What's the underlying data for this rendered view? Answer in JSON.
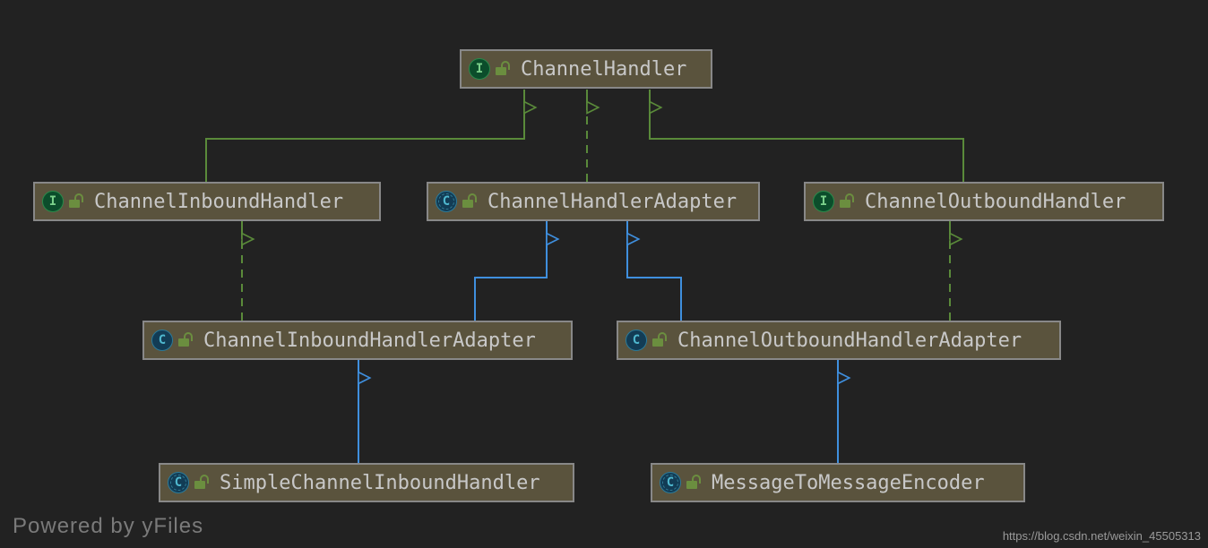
{
  "chart_data": {
    "type": "uml_class_hierarchy",
    "nodes": [
      {
        "id": "ch",
        "kind": "interface",
        "label": "ChannelHandler"
      },
      {
        "id": "cih",
        "kind": "interface",
        "label": "ChannelInboundHandler"
      },
      {
        "id": "cha",
        "kind": "abstract",
        "label": "ChannelHandlerAdapter"
      },
      {
        "id": "coh",
        "kind": "interface",
        "label": "ChannelOutboundHandler"
      },
      {
        "id": "ciha",
        "kind": "class",
        "label": "ChannelInboundHandlerAdapter"
      },
      {
        "id": "coha",
        "kind": "class",
        "label": "ChannelOutboundHandlerAdapter"
      },
      {
        "id": "scih",
        "kind": "abstract",
        "label": "SimpleChannelInboundHandler"
      },
      {
        "id": "m2me",
        "kind": "abstract",
        "label": "MessageToMessageEncoder"
      }
    ],
    "edges": [
      {
        "from": "cih",
        "to": "ch",
        "relation": "implements"
      },
      {
        "from": "cha",
        "to": "ch",
        "relation": "implements"
      },
      {
        "from": "coh",
        "to": "ch",
        "relation": "implements"
      },
      {
        "from": "ciha",
        "to": "cih",
        "relation": "implements"
      },
      {
        "from": "ciha",
        "to": "cha",
        "relation": "extends"
      },
      {
        "from": "coha",
        "to": "cha",
        "relation": "extends"
      },
      {
        "from": "coha",
        "to": "coh",
        "relation": "implements"
      },
      {
        "from": "scih",
        "to": "ciha",
        "relation": "extends"
      },
      {
        "from": "m2me",
        "to": "coha",
        "relation": "extends"
      }
    ],
    "colors": {
      "implements": "#5a8a3a",
      "extends": "#3f8fde"
    }
  },
  "nodes": {
    "ch": {
      "label": "ChannelHandler"
    },
    "cih": {
      "label": "ChannelInboundHandler"
    },
    "cha": {
      "label": "ChannelHandlerAdapter"
    },
    "coh": {
      "label": "ChannelOutboundHandler"
    },
    "ciha": {
      "label": "ChannelInboundHandlerAdapter"
    },
    "coha": {
      "label": "ChannelOutboundHandlerAdapter"
    },
    "scih": {
      "label": "SimpleChannelInboundHandler"
    },
    "m2me": {
      "label": "MessageToMessageEncoder"
    }
  },
  "kind_glyph": {
    "interface": "I",
    "class": "C",
    "abstract": "C"
  },
  "watermarks": {
    "left": "Powered by yFiles",
    "right": "https://blog.csdn.net/weixin_45505313"
  }
}
